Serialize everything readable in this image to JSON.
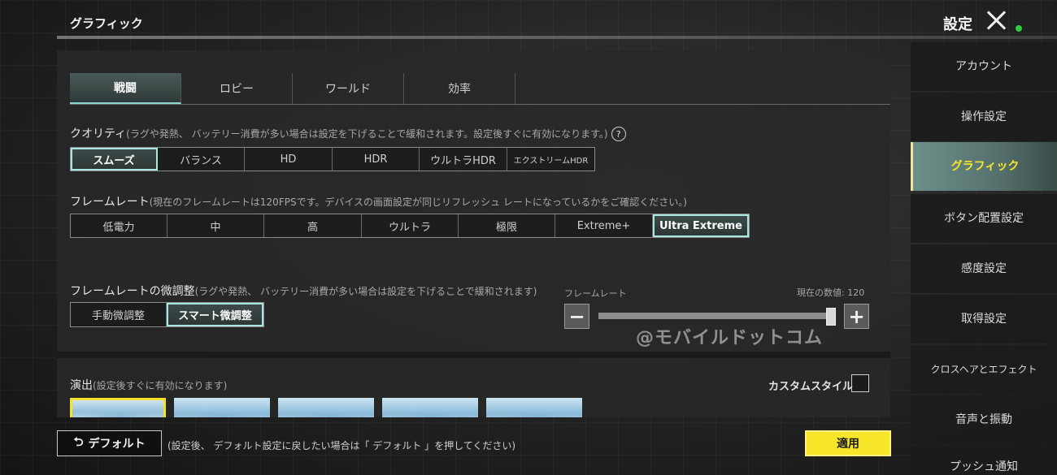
{
  "header": {
    "page_title": "グラフィック",
    "settings_label": "設定",
    "colors": {
      "status_dot": "#2ecc40",
      "accent": "#f7e62a"
    }
  },
  "tabs": [
    {
      "label": "戦闘",
      "active": true
    },
    {
      "label": "ロビー",
      "active": false
    },
    {
      "label": "ワールド",
      "active": false
    },
    {
      "label": "効率",
      "active": false
    }
  ],
  "quality": {
    "label": "クオリティ",
    "note": "(ラグや発熱、 バッテリー消費が多い場合は設定を下げることで緩和されます。設定後すぐに有効になります。)",
    "options": [
      "スムーズ",
      "バランス",
      "HD",
      "HDR",
      "ウルトラHDR",
      "エクストリームHDR"
    ],
    "selected": "スムーズ"
  },
  "frame_rate": {
    "label": "フレームレート",
    "note": "(現在のフレームレートは120FPSです。デバイスの画面設定が同じリフレッシュ レートになっているかをご確認ください。)",
    "options": [
      "低電力",
      "中",
      "高",
      "ウルトラ",
      "極限",
      "Extreme+",
      "Ultra Extreme"
    ],
    "selected": "Ultra Extreme"
  },
  "fine_tune": {
    "label": "フレームレートの微調整",
    "note": "(ラグや発熱、 バッテリー消費が多い場合は設定を下げることで緩和されます)",
    "options": [
      "手動微調整",
      "スマート微調整"
    ],
    "selected": "スマート微調整",
    "slider_label": "フレームレート",
    "slider_value_text": "現在の数値: 120",
    "slider_fraction": 0.985,
    "minus_symbol": "−",
    "plus_symbol": "+"
  },
  "watermark": "@モバイルドットコム",
  "effects": {
    "label": "演出",
    "note": "(設定後すぐに有効になります)",
    "custom_style_label": "カスタムスタイル",
    "custom_style_checked": false,
    "thumbnail_count": 5,
    "selected_index": 0
  },
  "sidebar": {
    "items": [
      {
        "label": "アカウント",
        "active": false
      },
      {
        "label": "操作設定",
        "active": false
      },
      {
        "label": "グラフィック",
        "active": true
      },
      {
        "label": "ボタン配置設定",
        "active": false
      },
      {
        "label": "感度設定",
        "active": false
      },
      {
        "label": "取得設定",
        "active": false
      },
      {
        "label": "クロスヘアとエフェクト",
        "active": false
      },
      {
        "label": "音声と振動",
        "active": false
      },
      {
        "label": "プッシュ通知",
        "active": false
      }
    ]
  },
  "footer": {
    "default_icon": "undo-icon",
    "default_label": "デフォルト",
    "default_note": "(設定後、 デフォルト設定に戻したい場合は「 デフォルト 」を押してください)",
    "apply_label": "適用"
  }
}
